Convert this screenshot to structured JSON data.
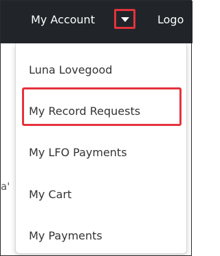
{
  "header": {
    "account_label": "My Account",
    "logout_label": "Logo",
    "toggle_icon": "caret-down-icon"
  },
  "background": {
    "fragment": "a'"
  },
  "dropdown": {
    "items": [
      {
        "label": "Luna Lovegood"
      },
      {
        "label": "My Record Requests",
        "highlighted": true
      },
      {
        "label": "My LFO Payments"
      },
      {
        "label": "My Cart"
      },
      {
        "label": "My Payments"
      }
    ]
  },
  "colors": {
    "nav_background": "#212529",
    "highlight_border": "#e5323d",
    "menu_text": "#333333"
  }
}
